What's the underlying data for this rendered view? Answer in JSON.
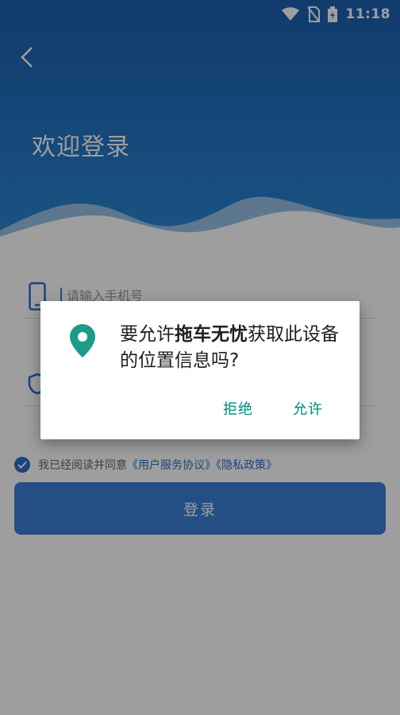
{
  "status_bar": {
    "time": "11:18"
  },
  "header": {
    "title": "欢迎登录"
  },
  "form": {
    "phone_placeholder": "请输入手机号",
    "agreement_prefix": "我已经阅读并同意",
    "user_agreement": "《用户服务协议》",
    "privacy_policy": "《隐私政策》",
    "login_label": "登录"
  },
  "dialog": {
    "msg_before": "要允许",
    "app_name": "拖车无忧",
    "msg_after": "获取此设备的位置信息吗?",
    "deny_label": "拒绝",
    "allow_label": "允许"
  },
  "colors": {
    "header_top": "#1c5fb0",
    "header_bottom": "#2a86d3",
    "accent": "#2d6fc6",
    "dialog_button": "#00897b",
    "location_icon": "#1e9a8a"
  }
}
